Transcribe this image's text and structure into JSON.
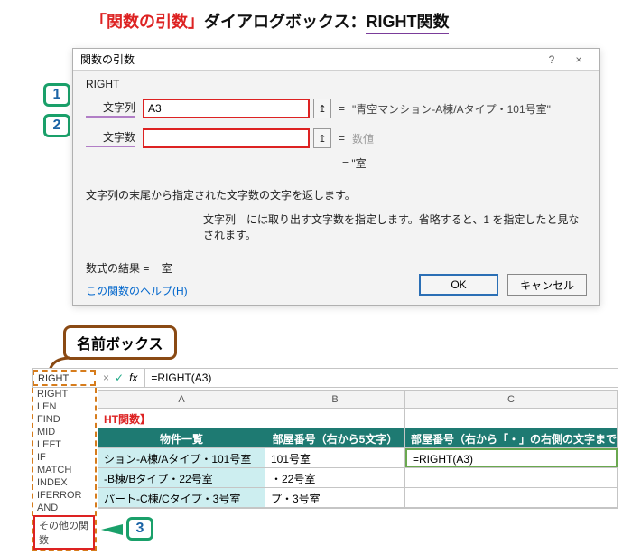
{
  "title": {
    "prefix": "「関数の引数」",
    "middle": "ダイアログボックス：",
    "func": "RIGHT関数"
  },
  "dialog": {
    "title": "関数の引数",
    "help_icon": "?",
    "close_icon": "×",
    "func_name": "RIGHT",
    "arg1": {
      "label": "文字列",
      "value": "A3",
      "result": "\"青空マンション-A棟/Aタイプ・101号室\""
    },
    "arg2": {
      "label": "文字数",
      "value": "",
      "placeholder_result": "数値"
    },
    "preview": "=  \"室",
    "desc1": "文字列の末尾から指定された文字数の文字を返します。",
    "desc2": "文字列　には取り出す文字数を指定します。省略すると、1 を指定したと見なされます。",
    "result_label": "数式の結果 =",
    "result_value": "室",
    "help_link": "この関数のヘルプ(H)",
    "ok": "OK",
    "cancel": "キャンセル"
  },
  "steps": {
    "s1": "1",
    "s2": "2",
    "s3": "3"
  },
  "namebox_callout": "名前ボックス",
  "formula_bar": {
    "name_box": "RIGHT",
    "fx_x": "×",
    "fx_check": "✓",
    "fx_label": "fx",
    "formula": "=RIGHT(A3)"
  },
  "func_dropdown": {
    "items": [
      "RIGHT",
      "LEN",
      "FIND",
      "MID",
      "LEFT",
      "IF",
      "MATCH",
      "INDEX",
      "IFERROR",
      "AND"
    ],
    "other": "その他の関数"
  },
  "sheet": {
    "cols": {
      "a": "A",
      "b": "B",
      "c": "C"
    },
    "title_row": "HT関数】",
    "headers": {
      "a": "物件一覧",
      "b": "部屋番号（右から5文字）",
      "c": "部屋番号（右から「・」の右側の文字まで）"
    },
    "rows": [
      {
        "a": "ション-A棟/Aタイプ・101号室",
        "b": "101号室",
        "c": "=RIGHT(A3)"
      },
      {
        "a": "-B棟/Bタイプ・22号室",
        "b": "・22号室",
        "c": ""
      },
      {
        "a": "パート-C棟/Cタイプ・3号室",
        "b": "プ・3号室",
        "c": ""
      }
    ]
  }
}
